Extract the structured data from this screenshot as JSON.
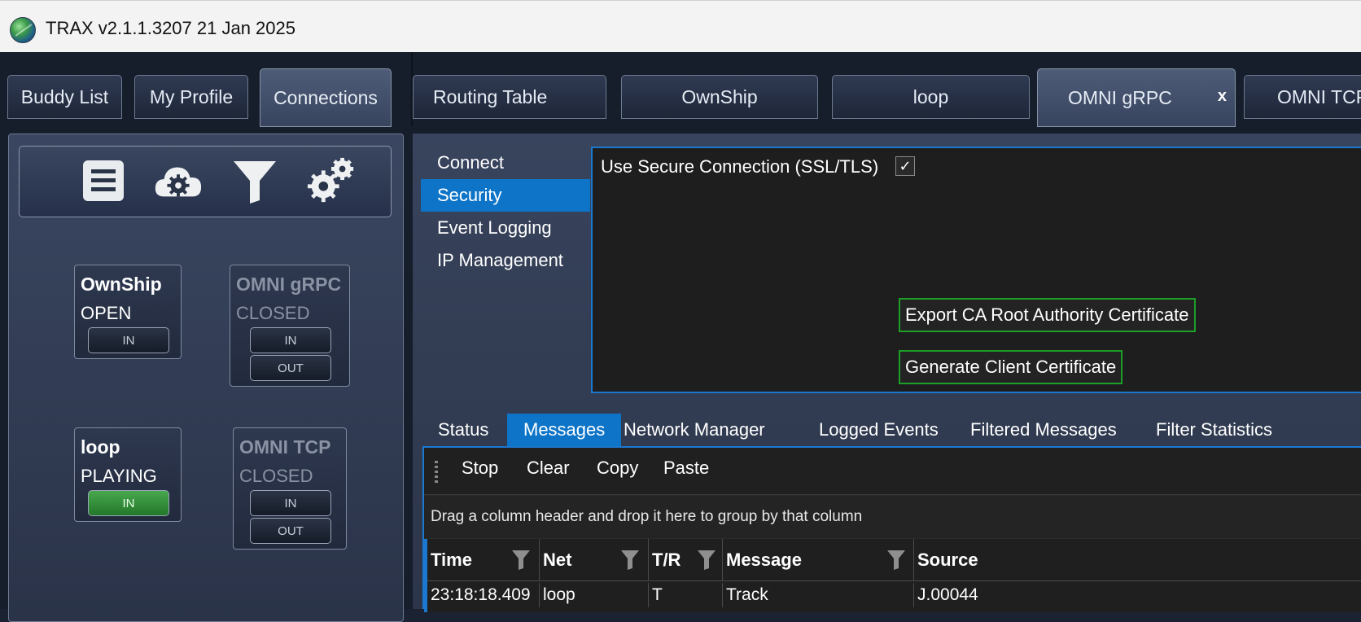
{
  "window": {
    "title": "TRAX v2.1.1.3207 21 Jan 2025"
  },
  "tabs": [
    {
      "label": "Buddy List"
    },
    {
      "label": "My Profile"
    },
    {
      "label": "Connections"
    },
    {
      "label": "Routing Table"
    },
    {
      "label": "OwnShip"
    },
    {
      "label": "loop"
    },
    {
      "label": "OMNI gRPC",
      "close": "x"
    },
    {
      "label": "OMNI TCP"
    }
  ],
  "toolbar_icons": [
    "list-icon",
    "cloud-settings-icon",
    "filter-icon",
    "gears-icon"
  ],
  "connections": [
    {
      "name": "OwnShip",
      "state": "OPEN",
      "in": "IN"
    },
    {
      "name": "OMNI gRPC",
      "state": "CLOSED",
      "in": "IN",
      "out": "OUT"
    },
    {
      "name": "loop",
      "state": "PLAYING",
      "in": "IN"
    },
    {
      "name": "OMNI TCP",
      "state": "CLOSED",
      "in": "IN",
      "out": "OUT"
    }
  ],
  "settings_nav": [
    "Connect",
    "Security",
    "Event Logging",
    "IP Management"
  ],
  "security": {
    "secure_label": "Use Secure Connection (SSL/TLS)",
    "secure_checked": true,
    "check_glyph": "✓",
    "export_button": "Export CA Root Authority Certificate",
    "generate_button": "Generate Client Certificate"
  },
  "bottom_tabs": [
    "Status",
    "Messages",
    "Network Manager",
    "Logged Events",
    "Filtered Messages",
    "Filter Statistics"
  ],
  "message_toolbar": [
    "Stop",
    "Clear",
    "Copy",
    "Paste"
  ],
  "group_hint": "Drag a column header and drop it here to group by that column",
  "columns": [
    "Time",
    "Net",
    "T/R",
    "Message",
    "Source"
  ],
  "rows": [
    [
      "23:18:18.409",
      "loop",
      "T",
      "Track",
      "J.00044"
    ]
  ],
  "colors": {
    "accent": "#0d74c8",
    "green_border": "#1d9e26",
    "playing": "#2e8f35"
  }
}
